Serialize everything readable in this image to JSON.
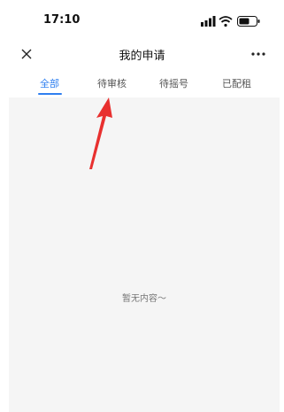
{
  "status_bar": {
    "time": "17:10",
    "icons": [
      "signal-icon",
      "wifi-icon",
      "battery-icon"
    ]
  },
  "nav": {
    "title": "我的申请",
    "close_icon": "close-icon",
    "more_icon": "more-icon"
  },
  "tabs": [
    {
      "label": "全部",
      "active": true
    },
    {
      "label": "待审核",
      "active": false
    },
    {
      "label": "待摇号",
      "active": false
    },
    {
      "label": "已配租",
      "active": false
    }
  ],
  "content": {
    "empty_message": "暂无内容～"
  },
  "colors": {
    "accent": "#2f7ff0",
    "annotation": "#e8302f",
    "content_bg": "#f5f5f5"
  }
}
